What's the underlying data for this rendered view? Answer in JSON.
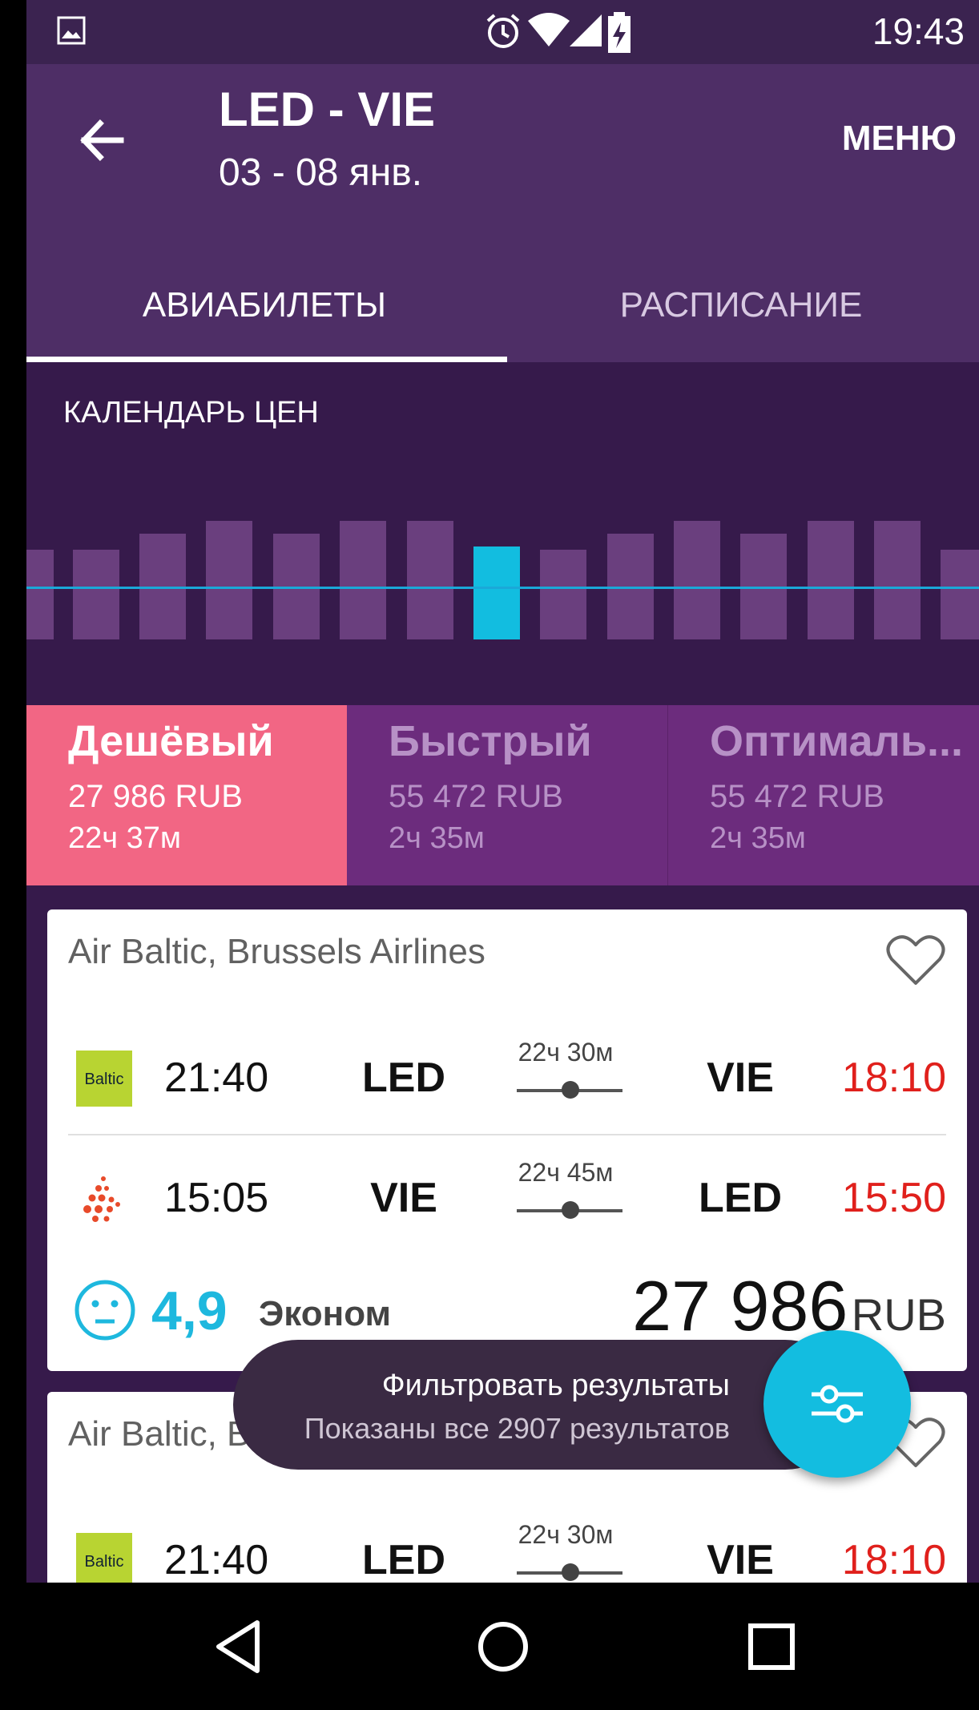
{
  "status_bar": {
    "time": "19:43"
  },
  "header": {
    "route": "LED - VIE",
    "dates": "03 - 08 янв.",
    "menu_label": "МЕНЮ"
  },
  "tabs": [
    {
      "label": "АВИАБИЛЕТЫ",
      "active": true
    },
    {
      "label": "РАСПИСАНИЕ",
      "active": false
    }
  ],
  "price_calendar": {
    "title": "КАЛЕНДАРЬ ЦЕН",
    "selected_index": 7
  },
  "sort_options": [
    {
      "name": "Дешёвый",
      "price": "27 986 RUB",
      "duration": "22ч 37м",
      "active": true
    },
    {
      "name": "Быстрый",
      "price": "55 472 RUB",
      "duration": "2ч 35м",
      "active": false
    },
    {
      "name": "Оптималь...",
      "price": "55 472 RUB",
      "duration": "2ч 35м",
      "active": false
    }
  ],
  "results": [
    {
      "airlines": "Air Baltic, Brussels Airlines",
      "legs": [
        {
          "dep_time": "21:40",
          "from": "LED",
          "duration": "22ч 30м",
          "to": "VIE",
          "arr_time": "18:10",
          "logo": "baltic-logo"
        },
        {
          "dep_time": "15:05",
          "from": "VIE",
          "duration": "22ч 45м",
          "to": "LED",
          "arr_time": "15:50",
          "logo": "brussels-airlines-logo"
        }
      ],
      "rating": "4,9",
      "cabin": "Эконом",
      "price": "27 986",
      "currency": "RUB"
    },
    {
      "airlines": "Air Baltic, Brussels Airlines",
      "legs": [
        {
          "dep_time": "21:40",
          "from": "LED",
          "duration": "22ч 30м",
          "to": "VIE",
          "arr_time": "18:10",
          "logo": "baltic-logo"
        }
      ]
    }
  ],
  "filter_snackbar": {
    "title": "Фильтровать результаты",
    "subtitle": "Показаны все 2907 результатов"
  },
  "logo_text": {
    "baltic": "Baltic"
  },
  "colors": {
    "accent": "#13bde0",
    "header": "#4e2e66",
    "active_sort": "#f26684",
    "arrival_time": "#e0201c"
  }
}
